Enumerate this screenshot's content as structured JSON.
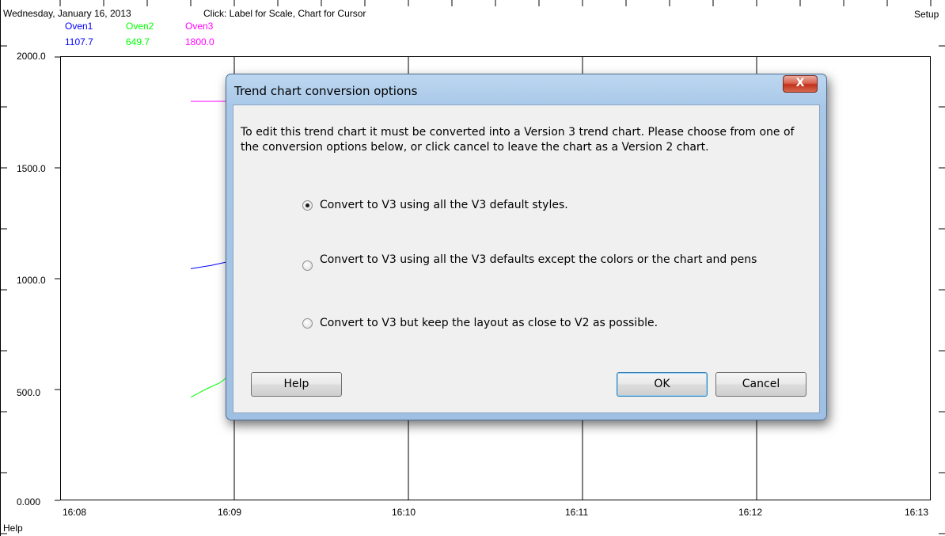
{
  "header": {
    "date": "Wednesday, January 16, 2013",
    "instruction": "Click: Label for Scale, Chart for Cursor",
    "setup_label": "Setup"
  },
  "pens": [
    {
      "name": "Oven1",
      "value": "1107.7",
      "color": "#0000ff"
    },
    {
      "name": "Oven2",
      "value": "649.7",
      "color": "#00ff00"
    },
    {
      "name": "Oven3",
      "value": "1800.0",
      "color": "#ff00ff"
    }
  ],
  "status_bar": {
    "help_label": "Help"
  },
  "chart_data": {
    "type": "line",
    "ylim": [
      0,
      2000
    ],
    "y_ticks": [
      "2000.0",
      "1500.0",
      "1000.0",
      "500.0",
      "0.000"
    ],
    "x_ticks": [
      "16:08",
      "16:09",
      "16:10",
      "16:11",
      "16:12",
      "16:13"
    ],
    "series": [
      {
        "name": "Oven1",
        "color": "#0000ff",
        "x": [
          "16:08:45",
          "16:08:52",
          "16:08:59"
        ],
        "y": [
          1045,
          1060,
          1080
        ]
      },
      {
        "name": "Oven2",
        "color": "#00ff00",
        "x": [
          "16:08:45",
          "16:08:50",
          "16:08:55",
          "16:08:59"
        ],
        "y": [
          465,
          500,
          530,
          570
        ]
      },
      {
        "name": "Oven3",
        "color": "#ff00ff",
        "x": [
          "16:08:45",
          "16:08:59"
        ],
        "y": [
          1800,
          1800
        ]
      }
    ],
    "grid": true
  },
  "dialog": {
    "title": "Trend chart conversion options",
    "close_label": "X",
    "message": "To edit this trend chart it must be converted into a Version 3 trend chart. Please choose from one of the conversion options below, or click cancel to leave the chart as a Version 2 chart.",
    "options": [
      {
        "label": "Convert to V3 using all the V3 default styles.",
        "checked": true
      },
      {
        "label": "Convert to V3 using all the V3 defaults except the colors or the chart and pens",
        "checked": false
      },
      {
        "label": "Convert to V3 but keep the layout as close to V2 as possible.",
        "checked": false
      }
    ],
    "help_button": "Help",
    "ok_button": "OK",
    "cancel_button": "Cancel"
  }
}
